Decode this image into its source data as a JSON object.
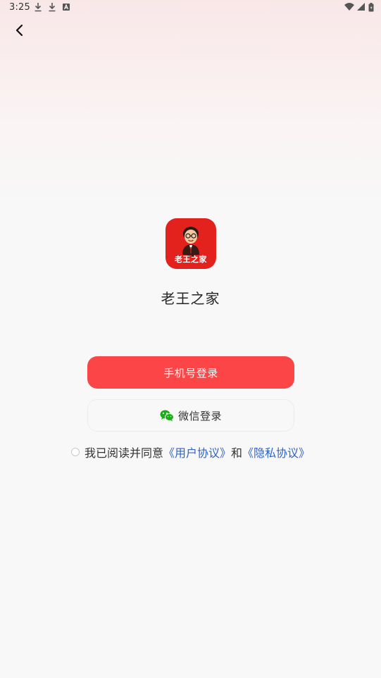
{
  "status_bar": {
    "time": "3:25",
    "left_icons": [
      "download-icon",
      "download-icon",
      "font-icon"
    ],
    "right_icons": [
      "wifi-icon",
      "signal-icon",
      "battery-icon"
    ]
  },
  "header": {
    "back_icon": "chevron-left-icon"
  },
  "app": {
    "logo_caption": "老王之家",
    "name": "老王之家",
    "brand_color": "#e3221e"
  },
  "buttons": {
    "phone_login": "手机号登录",
    "phone_login_color": "#fb4546",
    "wechat_login": "微信登录",
    "wechat_icon": "wechat-icon",
    "wechat_icon_color": "#1aad19"
  },
  "agreement": {
    "prefix": "我已阅读并同意",
    "user_agreement": "《用户协议》",
    "conjunction": "和",
    "privacy_policy": "《隐私协议》",
    "link_color": "#2f63c8",
    "checked": false
  }
}
